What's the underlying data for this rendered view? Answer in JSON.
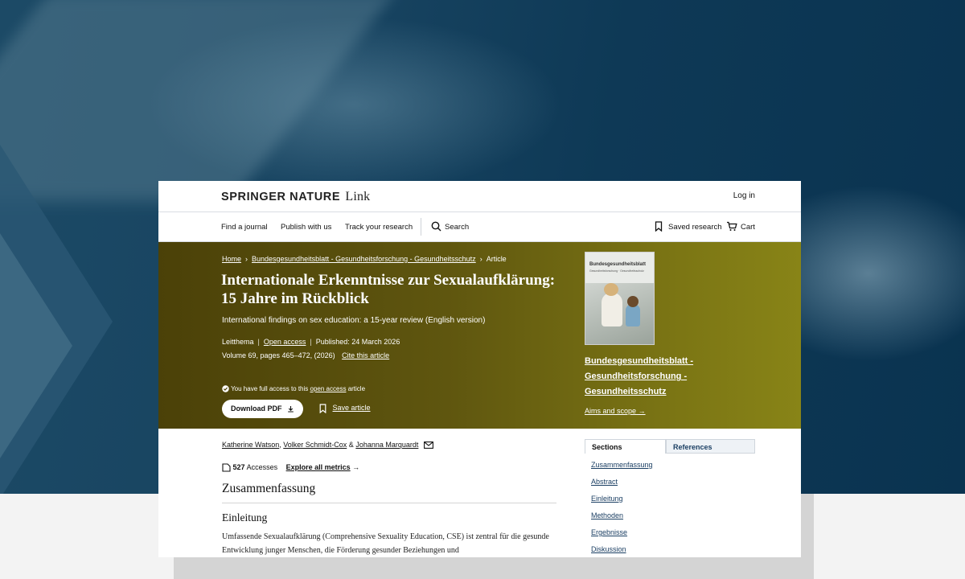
{
  "brand": {
    "name": "SPRINGER NATURE",
    "suffix": "Link"
  },
  "header": {
    "login_label": "Log in"
  },
  "nav": {
    "find_journal": "Find a journal",
    "publish": "Publish with us",
    "track": "Track your research",
    "search": "Search",
    "saved": "Saved research",
    "cart": "Cart"
  },
  "breadcrumb": {
    "home": "Home",
    "journal": "Bundesgesundheitsblatt - Gesundheitsforschung - Gesundheitsschutz",
    "current": "Article"
  },
  "article": {
    "title": "Internationale Erkenntnisse zur Sexualaufklärung: 15 Jahre im Rückblick",
    "subtitle": "International findings on sex education: a 15-year review (English version)",
    "type": "Leitthema",
    "open_access": "Open access",
    "published": "Published: 24 March 2026",
    "volume": "Volume 69, pages 465–472, (2026)",
    "cite": "Cite this article",
    "access_prefix": "You have full access to this",
    "access_link": "open access",
    "access_suffix": "article",
    "download_label": "Download PDF",
    "save_label": "Save article"
  },
  "journal": {
    "cover_title": "Bundesgesundheitsblatt",
    "cover_subtitle": "Gesundheitsforschung · Gesundheitsschutz",
    "name": "Bundesgesundheitsblatt - Gesundheitsforschung - Gesundheitsschutz",
    "aims": "Aims and scope"
  },
  "authors": {
    "a1": "Katherine Watson",
    "a2": "Volker Schmidt-Cox",
    "amp": "&",
    "a3": "Johanna Marquardt"
  },
  "metrics": {
    "count": "527",
    "label": "Accesses",
    "explore": "Explore all metrics"
  },
  "sections": {
    "zusammenfassung": "Zusammenfassung",
    "einleitung": "Einleitung",
    "body": "Umfassende Sexualaufklärung (Comprehensive Sexuality Education, CSE) ist zentral für die gesunde Entwicklung junger Menschen, die Förderung gesunder Beziehungen und"
  },
  "sidebar": {
    "tab_sections": "Sections",
    "tab_references": "References",
    "toc": [
      "Zusammenfassung",
      "Abstract",
      "Einleitung",
      "Methoden",
      "Ergebnisse",
      "Diskussion"
    ]
  },
  "colors": {
    "hero_start": "#4b4108",
    "hero_end": "#888417",
    "link": "#1b3f63",
    "background": "#0b3550"
  }
}
